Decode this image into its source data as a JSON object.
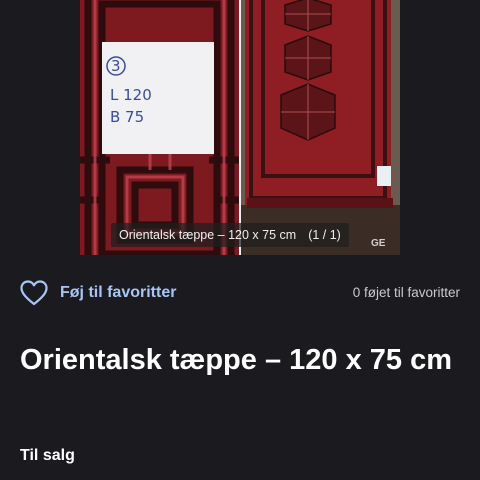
{
  "gallery": {
    "caption": "Orientalsk tæppe – 120 x 75 cm",
    "counter": "(1 / 1)",
    "note": {
      "number": "3",
      "line1": "L 120",
      "line2": "B 75"
    },
    "watermark": "GE"
  },
  "favorites": {
    "label": "Føj til favoritter",
    "count_text": "0 føjet til favoritter"
  },
  "listing": {
    "title": "Orientalsk tæppe – 120 x 75 cm",
    "status": "Til salg"
  },
  "colors": {
    "background": "#1b1b1f",
    "accent": "#a8c6f5",
    "rug_red": "#8e1e24",
    "rug_dark": "#3a1012"
  }
}
